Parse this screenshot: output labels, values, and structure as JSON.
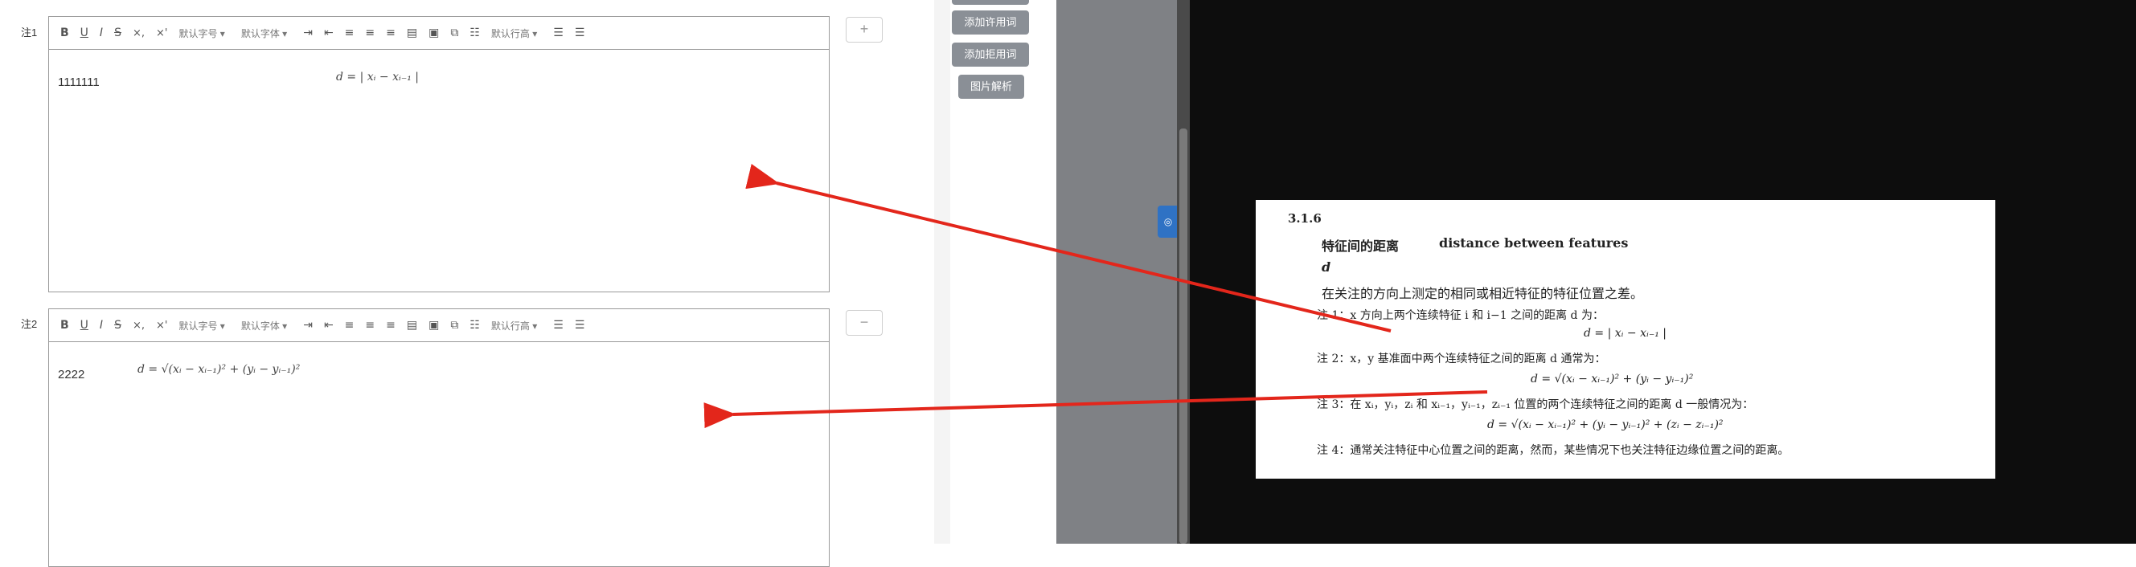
{
  "toolbar": {
    "bold": "B",
    "underline": "U",
    "italic": "I",
    "strike": "S",
    "subscript": "×,",
    "superscript": "×'",
    "font_size": "默认字号",
    "font_family": "默认字体",
    "line_height": "默认行高"
  },
  "notes": [
    {
      "label": "注1",
      "text": "1111111",
      "formula": "d = | xᵢ − xᵢ₋₁ |",
      "side_button": "+"
    },
    {
      "label": "注2",
      "text": "2222",
      "formula": "d = √(xᵢ − xᵢ₋₁)² + (yᵢ − yᵢ₋₁)²",
      "side_button": "−"
    }
  ],
  "side_buttons": [
    "添加许用词",
    "添加拒用词",
    "图片解析"
  ],
  "document": {
    "section": "3.1.6",
    "term_zh": "特征间的距离",
    "term_en": "distance between features",
    "symbol": "d",
    "definition": "在关注的方向上测定的相同或相近特征的特征位置之差。",
    "note1": "注 1：x 方向上两个连续特征 i 和 i−1 之间的距离 d 为：",
    "note1_formula": "d = | xᵢ − xᵢ₋₁ |",
    "note2": "注 2：x，y 基准面中两个连续特征之间的距离 d 通常为：",
    "note2_formula": "d = √(xᵢ − xᵢ₋₁)² + (yᵢ − yᵢ₋₁)²",
    "note3": "注 3：在 xᵢ，yᵢ，zᵢ 和 xᵢ₋₁，yᵢ₋₁，zᵢ₋₁ 位置的两个连续特征之间的距离 d 一般情况为：",
    "note3_formula": "d = √(xᵢ − xᵢ₋₁)² + (yᵢ − yᵢ₋₁)² + (zᵢ − zᵢ₋₁)²",
    "note4": "注 4：通常关注特征中心位置之间的距离，然而，某些情况下也关注特征边缘位置之间的距离。"
  },
  "colors": {
    "arrow": "#e3261b",
    "button_gray": "#8a8f96",
    "panel_gray": "#7f8185",
    "dark": "#0d0d0d"
  },
  "icons": [
    "align-left-icon",
    "align-center-icon",
    "align-right-icon",
    "justify-icon",
    "image-icon",
    "link-icon",
    "divider-icon",
    "bullet-list-icon",
    "ordered-list-icon"
  ]
}
